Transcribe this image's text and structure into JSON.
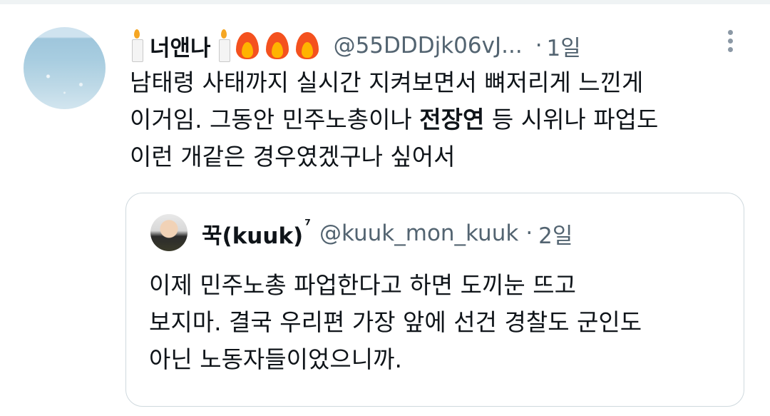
{
  "tweet": {
    "display_name": "너앤나",
    "handle": "@55DDDjk06vJ...",
    "dot": "·",
    "time": "1일",
    "text_lines": [
      "남태령 사태까지 실시간 지켜보면서 뼈저리게 느낀게",
      "이거임. 그동안 민주노총이나 ",
      "이런 개같은 경우였겠구나 싶어서"
    ],
    "bold_text": "전장연",
    "after_bold": " 등 시위나 파업도"
  },
  "quote": {
    "display_name": "꾹(kuuk)",
    "superscript": "⁷",
    "handle": "@kuuk_mon_kuuk",
    "dot": "·",
    "time": "2일",
    "text_lines": [
      "이제 민주노총 파업한다고 하면 도끼눈 뜨고",
      "보지마. 결국 우리편 가장 앞에 선건 경찰도 군인도",
      "아닌 노동자들이었으니까."
    ]
  },
  "icons": {
    "candle": "candle-icon",
    "fire": "fire-icon",
    "more": "more-options-icon"
  },
  "colors": {
    "text": "#0f1419",
    "secondary": "#536471",
    "border": "#cfd9de"
  }
}
